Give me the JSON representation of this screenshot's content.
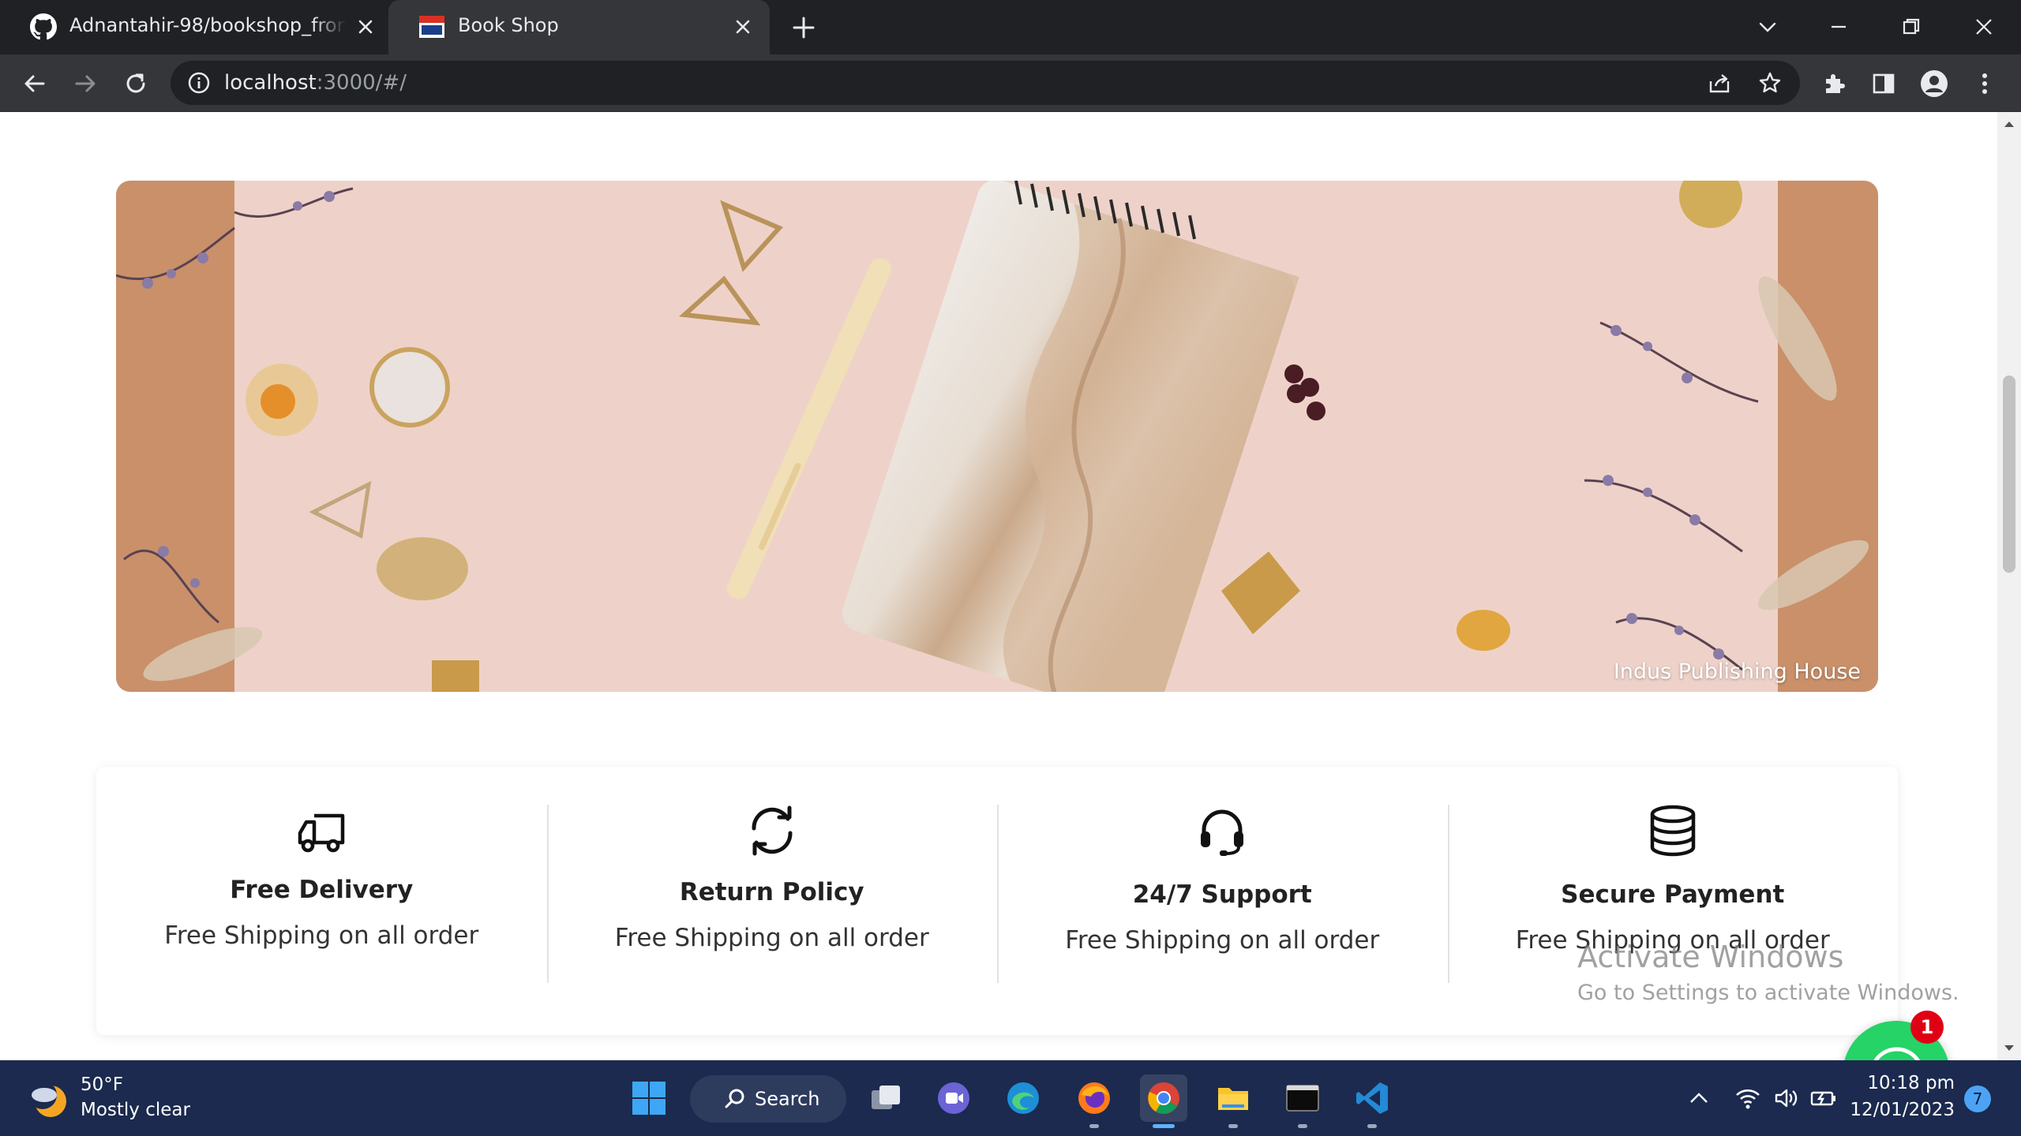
{
  "browser": {
    "tabs": [
      {
        "title": "Adnantahir-98/bookshop_frontend",
        "icon": "github-icon",
        "active": false
      },
      {
        "title": "Book Shop",
        "icon": "site-favicon",
        "active": true
      }
    ],
    "url_host": "localhost",
    "url_path": ":3000/#/"
  },
  "banner": {
    "caption": "Indus Publishing House"
  },
  "features": [
    {
      "icon": "truck-icon",
      "title": "Free Delivery",
      "desc": "Free Shipping on all order"
    },
    {
      "icon": "refresh-icon",
      "title": "Return Policy",
      "desc": "Free Shipping on all order"
    },
    {
      "icon": "headset-icon",
      "title": "24/7 Support",
      "desc": "Free Shipping on all order"
    },
    {
      "icon": "database-icon",
      "title": "Secure Payment",
      "desc": "Free Shipping on all order"
    }
  ],
  "watermark": {
    "title": "Activate Windows",
    "subtitle": "Go to Settings to activate Windows."
  },
  "whatsapp": {
    "badge_count": "1"
  },
  "taskbar": {
    "weather_temp": "50°F",
    "weather_desc": "Mostly clear",
    "search_label": "Search",
    "time": "10:18 pm",
    "date": "12/01/2023",
    "notification_count": "7"
  },
  "colors": {
    "whatsapp": "#25d366",
    "taskbar": "#1b2a4e",
    "chrome_dark": "#202124"
  }
}
